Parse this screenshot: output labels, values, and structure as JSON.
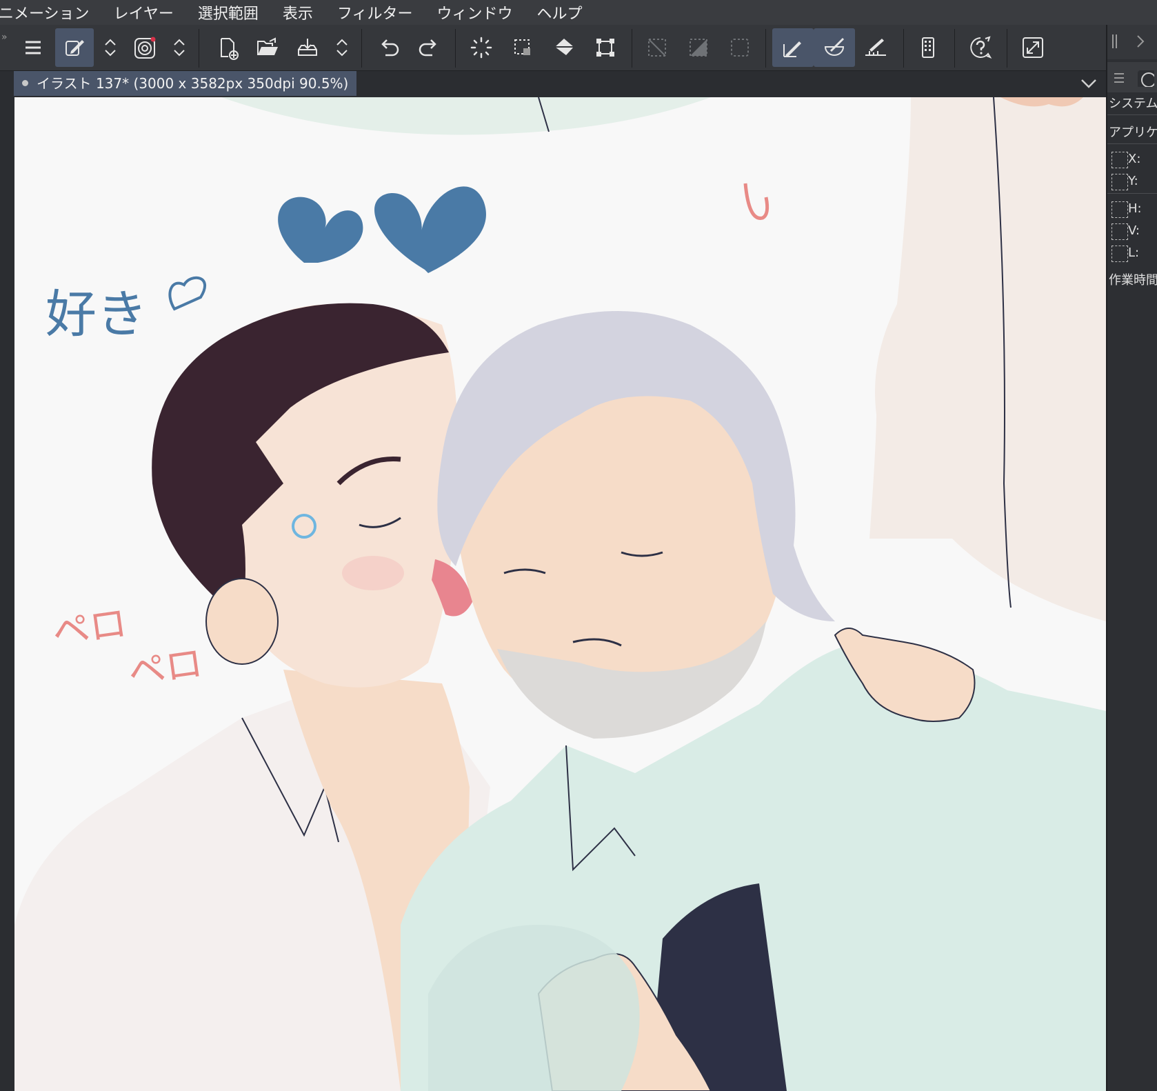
{
  "menu": [
    "ニメーション",
    "レイヤー",
    "選択範囲",
    "表示",
    "フィルター",
    "ウィンドウ",
    "ヘルプ"
  ],
  "document_tab": "イラスト 137* (3000 x 3582px 350dpi 90.5%)",
  "right_panel": {
    "rows": [
      "システム",
      "アプリケ",
      "X:",
      "Y:",
      "H:",
      "V:",
      "L:",
      "作業時間"
    ]
  },
  "toolbar_icons": [
    "hamburger-menu-icon",
    "quick-access-pen-icon",
    "up-down-arrows-icon",
    "ring-spiral-icon",
    "up-down-arrows-icon",
    "new-file-icon",
    "open-folder-icon",
    "import-tray-icon",
    "up-down-arrows-icon",
    "undo-icon",
    "redo-icon",
    "deselect-spinner-icon",
    "selection-marquee-icon",
    "fill-bucket-icon",
    "transform-icon",
    "clear-selection-icon",
    "fill-selection-icon",
    "selection-box-icon",
    "pen-ruler-icon",
    "brush-ruler-icon",
    "ruler-line-icon",
    "device-icon",
    "help-icon",
    "expand-icon"
  ],
  "illustration": {
    "handwritten_text": [
      "好き",
      "ペロ",
      "ペロ"
    ],
    "colors": {
      "heart": "#4a7aa6",
      "pink_text": "#e88a86",
      "canvas_bg": "#f8f8f8",
      "shirt_green": "#d9ece6",
      "hair_dark": "#3a2430",
      "hair_gray": "#d3d3df",
      "skin": "#f6dcc8",
      "tshirt": "#2d3045"
    }
  }
}
